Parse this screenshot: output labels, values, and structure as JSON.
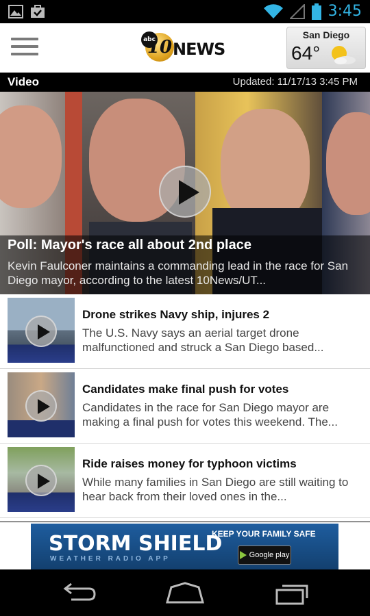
{
  "status_bar": {
    "time": "3:45"
  },
  "header": {
    "logo_badge": "abc",
    "logo_number": "10",
    "logo_text": "NEWS",
    "weather": {
      "city": "San Diego",
      "temp": "64°"
    }
  },
  "video_bar": {
    "label": "Video",
    "updated": "Updated: 11/17/13 3:45 PM"
  },
  "hero": {
    "title": "Poll: Mayor's race all about 2nd place",
    "description": "Kevin Faulconer maintains a commanding lead in the race for San Diego mayor, according to the latest 10News/UT..."
  },
  "stories": [
    {
      "title": "Drone strikes Navy ship, injures 2",
      "description": "The U.S. Navy says an aerial target drone malfunctioned and struck a San Diego based..."
    },
    {
      "title": "Candidates make final push for votes",
      "description": "Candidates in the race for San Diego mayor are making a final push for votes this weekend. The..."
    },
    {
      "title": "Ride raises money for typhoon victims",
      "description": "While many families in San Diego are still waiting to hear back from their loved ones in the..."
    }
  ],
  "ad": {
    "brand": "STORM SHIELD",
    "subtitle": "WEATHER RADIO APP",
    "tagline": "KEEP YOUR FAMILY SAFE",
    "store": "Google play"
  },
  "colors": {
    "accent": "#33b5e5",
    "ad_blue": "#1e5d9f"
  }
}
